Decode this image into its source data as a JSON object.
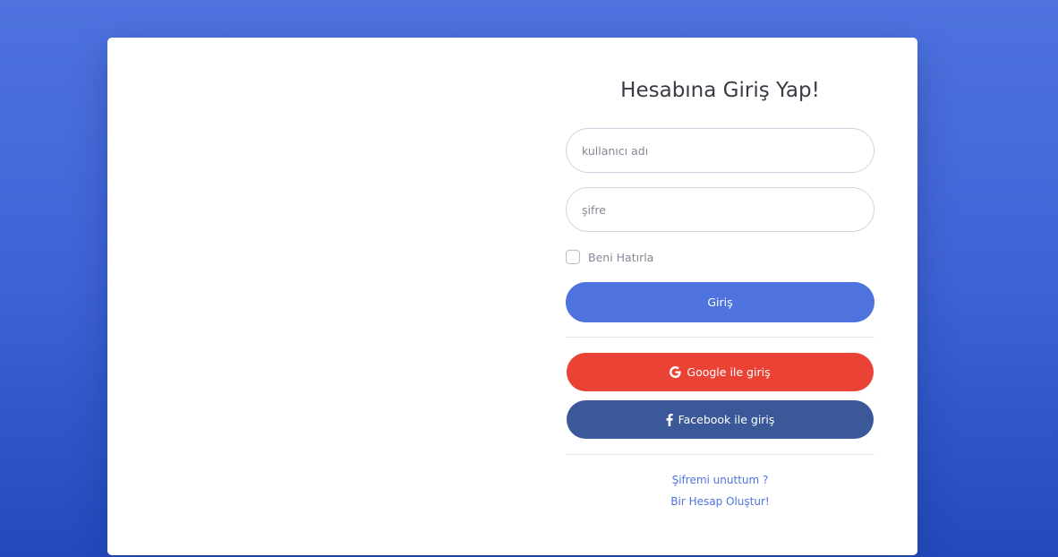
{
  "login": {
    "title": "Hesabına Giriş Yap!",
    "username_placeholder": "kullanıcı adı",
    "password_placeholder": "şifre",
    "remember_label": "Beni Hatırla",
    "login_button": "Giriş",
    "google_button": "Google ile giriş",
    "facebook_button": "Facebook ile giriş",
    "forgot_link": "Şifremi unuttum ?",
    "register_link": "Bir Hesap Oluştur!"
  },
  "icons": {
    "google": "google-icon",
    "facebook": "facebook-icon"
  },
  "colors": {
    "primary": "#4e73df",
    "google": "#ea4335",
    "facebook": "#3b5998",
    "background_top": "#4e73df",
    "background_bottom": "#224abe"
  }
}
